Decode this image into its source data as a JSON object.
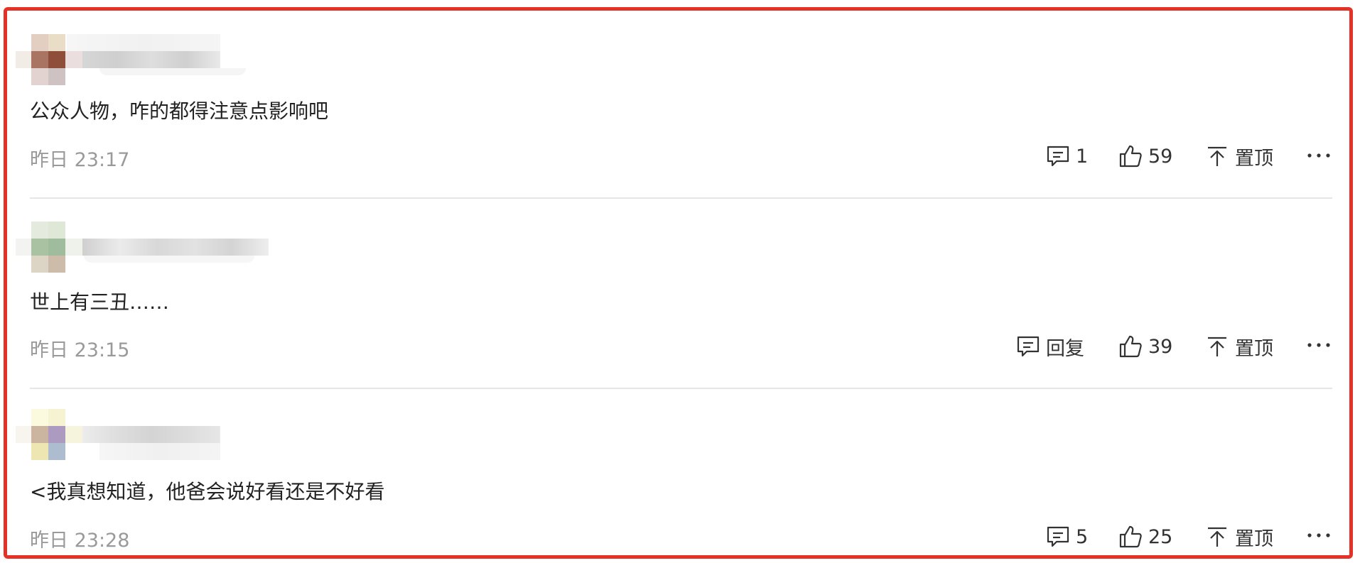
{
  "colors": {
    "frame": "#e53228",
    "text": "#222222",
    "meta": "#9a9a9a",
    "divider": "#e6e6e6"
  },
  "comments": [
    {
      "text": "公众人物，咋的都得注意点影响吧",
      "time": "昨日 23:17",
      "reply_label": "1",
      "likes": "59",
      "pin_label": "置顶"
    },
    {
      "text": "世上有三丑……",
      "time": "昨日 23:15",
      "reply_label": "回复",
      "likes": "39",
      "pin_label": "置顶"
    },
    {
      "text": "<我真想知道，他爸会说好看还是不好看",
      "time": "昨日 23:28",
      "reply_label": "5",
      "likes": "25",
      "pin_label": "置顶"
    }
  ],
  "icons": {
    "reply": "comment-bubble-icon",
    "like": "thumbs-up-icon",
    "pin": "pin-to-top-icon",
    "more": "more-horizontal-icon"
  }
}
